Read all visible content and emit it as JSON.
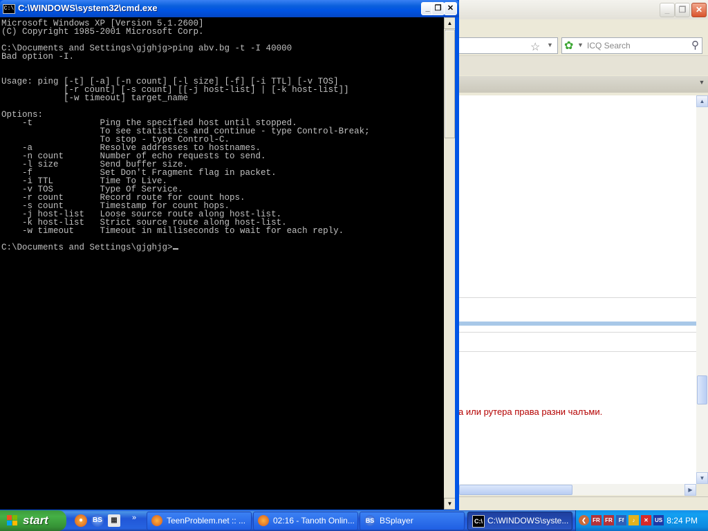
{
  "cmd": {
    "title": "C:\\WINDOWS\\system32\\cmd.exe",
    "icon_text": "C:\\",
    "output": "Microsoft Windows XP [Version 5.1.2600]\n(C) Copyright 1985-2001 Microsoft Corp.\n\nC:\\Documents and Settings\\gjghjg>ping abv.bg -t -I 40000\nBad option -I.\n\n\nUsage: ping [-t] [-a] [-n count] [-l size] [-f] [-i TTL] [-v TOS]\n            [-r count] [-s count] [[-j host-list] | [-k host-list]]\n            [-w timeout] target_name\n\nOptions:\n    -t             Ping the specified host until stopped.\n                   To see statistics and continue - type Control-Break;\n                   To stop - type Control-C.\n    -a             Resolve addresses to hostnames.\n    -n count       Number of echo requests to send.\n    -l size        Send buffer size.\n    -f             Set Don't Fragment flag in packet.\n    -i TTL         Time To Live.\n    -v TOS         Type Of Service.\n    -r count       Record route for count hops.\n    -s count       Timestamp for count hops.\n    -j host-list   Loose source route along host-list.\n    -k host-list   Strict source route along host-list.\n    -w timeout     Timeout in milliseconds to wait for each reply.\n\n",
    "prompt": "C:\\Documents and Settings\\gjghjg>",
    "buttons": {
      "minimize": "_",
      "maximize": "❐",
      "close": "✕"
    }
  },
  "browser": {
    "search_placeholder": "ICQ Search",
    "content_text": "а или рутера права разни чалъми.",
    "colors": {
      "content_text": "#b40000",
      "highlight_bar": "#a8c8e8"
    }
  },
  "taskbar": {
    "start_label": "start",
    "quick_launch": [
      {
        "icon": "firefox-icon"
      },
      {
        "icon": "bsplayer-icon",
        "text": "BS"
      },
      {
        "icon": "calculator-icon",
        "text": "▦"
      }
    ],
    "quick_launch_more": "»",
    "tasks": [
      {
        "label": "TeenProblem.net :: ...",
        "icon": "firefox-icon"
      },
      {
        "label": "02:16 - Tanoth Onlin...",
        "icon": "firefox-icon"
      },
      {
        "label": "BSplayer",
        "icon": "bsplayer-icon",
        "icon_text": "BS"
      },
      {
        "label": "C:\\WINDOWS\\syste...",
        "icon": "cmd-icon",
        "icon_text": "C:\\",
        "active": true
      }
    ],
    "tray": {
      "collapse": "❮",
      "icons": [
        "FR",
        "FR",
        "Ff",
        "♪",
        "✕",
        "US"
      ],
      "clock": "8:24 PM"
    }
  }
}
